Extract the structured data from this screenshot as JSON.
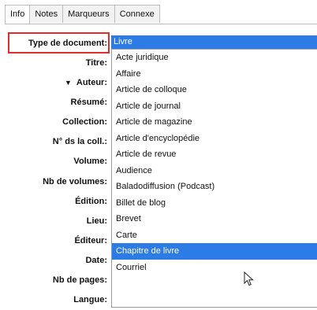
{
  "tabs": [
    "Info",
    "Notes",
    "Marqueurs",
    "Connexe"
  ],
  "active_tab": "Info",
  "fields": {
    "type_label": "Type de document:",
    "type_value": "Livre",
    "labels": [
      "Titre:",
      "Auteur:",
      "Résumé:",
      "Collection:",
      "N° ds la coll.:",
      "Volume:",
      "Nb de volumes:",
      "Édition:",
      "Lieu:",
      "Éditeur:",
      "Date:",
      "Nb de pages:",
      "Langue:"
    ]
  },
  "dropdown": {
    "options": [
      "Acte juridique",
      "Affaire",
      "Article de colloque",
      "Article de journal",
      "Article de magazine",
      "Article d'encyclopédie",
      "Article de revue",
      "Audience",
      "Baladodiffusion (Podcast)",
      "Billet de blog",
      "Brevet",
      "Carte",
      "Chapitre de livre",
      "Courriel"
    ],
    "highlighted": "Chapitre de livre"
  },
  "colors": {
    "selection": "#2d7be5",
    "highlight_border": "#e02d2d"
  }
}
